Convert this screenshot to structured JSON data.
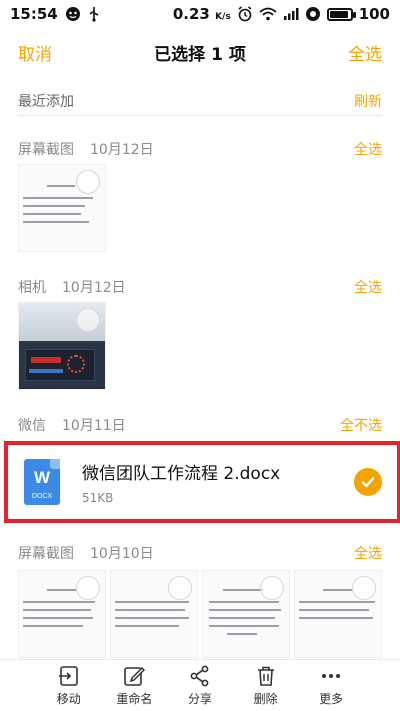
{
  "status_bar": {
    "time": "15:54",
    "speed": "0.23",
    "speed_unit": "K/s",
    "battery": "100",
    "battery_level_percent": 100
  },
  "title_bar": {
    "cancel_label": "取消",
    "title": "已选择 1 项",
    "select_all_label": "全选"
  },
  "recent": {
    "label": "最近添加",
    "refresh_label": "刷新"
  },
  "sections": [
    {
      "name": "屏幕截图",
      "date": "10月12日",
      "action": "全选"
    },
    {
      "name": "相机",
      "date": "10月12日",
      "action": "全选"
    },
    {
      "name": "微信",
      "date": "10月11日",
      "action": "全不选"
    },
    {
      "name": "屏幕截图",
      "date": "10月10日",
      "action": "全选"
    }
  ],
  "file": {
    "name": "微信团队工作流程 2.docx",
    "size": "51KB",
    "icon_letter": "W",
    "icon_ext": "DOCX",
    "selected": true
  },
  "colors": {
    "accent": "#f2a500",
    "highlight_border": "#e5222b",
    "doc_blue": "#3b8ae6"
  },
  "toolbar": [
    {
      "label": "移动",
      "icon": "move-icon"
    },
    {
      "label": "重命名",
      "icon": "rename-icon"
    },
    {
      "label": "分享",
      "icon": "share-icon"
    },
    {
      "label": "删除",
      "icon": "delete-icon"
    },
    {
      "label": "更多",
      "icon": "more-icon"
    }
  ]
}
